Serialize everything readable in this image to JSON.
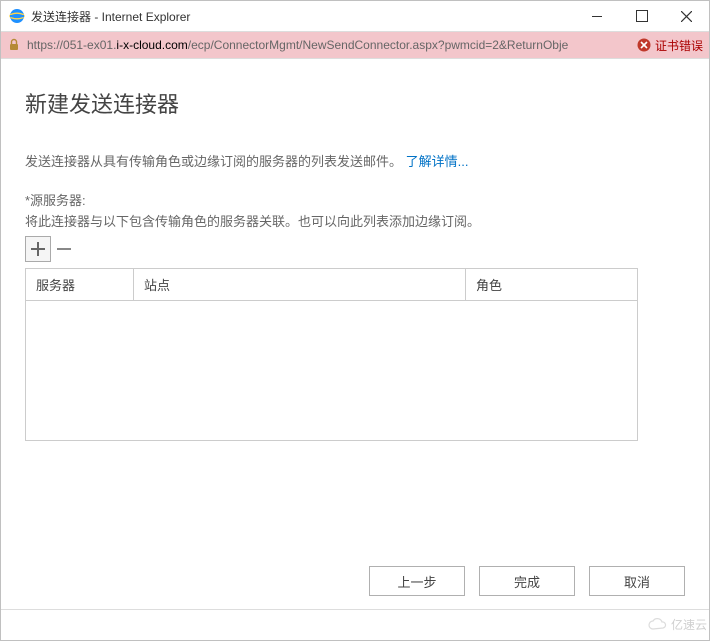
{
  "window": {
    "title": "发送连接器 - Internet Explorer"
  },
  "urlbar": {
    "proto": "https://",
    "host_pre": "051-ex01.",
    "domain": "i-x-cloud.com",
    "path": "/ecp/ConnectorMgmt/NewSendConnector.aspx?pwmcid=2&ReturnObje",
    "cert_error": "证书错误"
  },
  "page": {
    "title": "新建发送连接器",
    "desc_text": "发送连接器从具有传输角色或边缘订阅的服务器的列表发送邮件。",
    "learn_more": "了解详情...",
    "source_label": "*源服务器:",
    "source_desc": "将此连接器与以下包含传输角色的服务器关联。也可以向此列表添加边缘订阅。",
    "columns": {
      "server": "服务器",
      "site": "站点",
      "role": "角色"
    }
  },
  "buttons": {
    "back": "上一步",
    "finish": "完成",
    "cancel": "取消"
  },
  "watermark": "亿速云"
}
